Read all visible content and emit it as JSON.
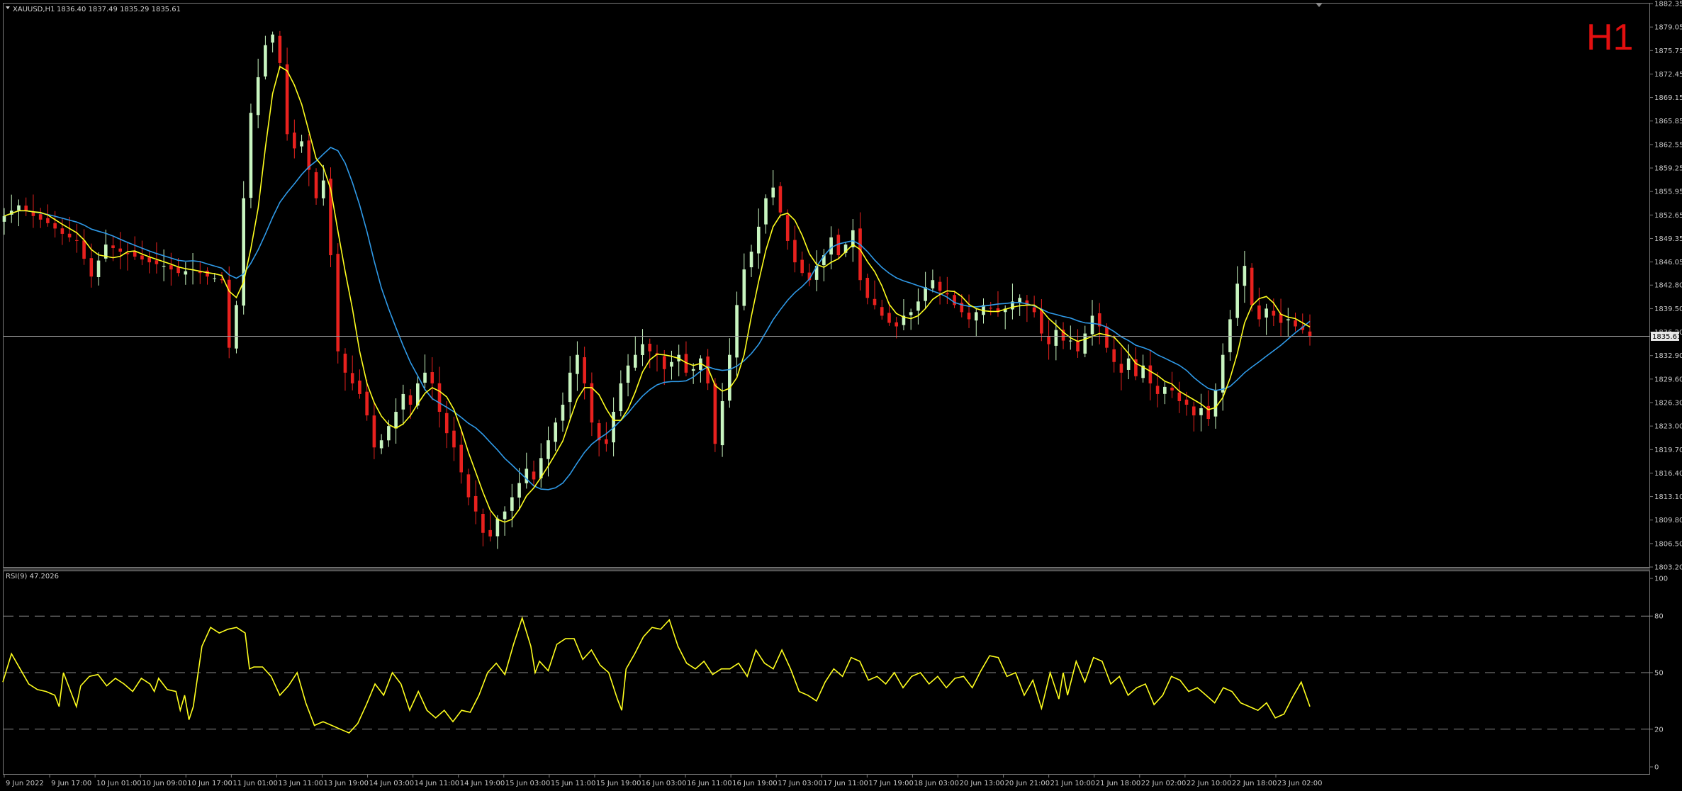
{
  "header": {
    "symbol": "XAUUSD,H1",
    "ohlc": "1836.40 1837.49 1835.29 1835.61",
    "menu_icon": "triangle-down-icon",
    "timeframe_badge": "H1"
  },
  "rsi_header": "RSI(9) 47.2026",
  "current_price_label": "1835.61",
  "colors": {
    "bull": "#c8f5c0",
    "bear": "#e8211e",
    "ma_fast": "#ffff1e",
    "ma_slow": "#2f9ae8",
    "rsi_line": "#ffff1e",
    "price_line": "#9a9a9a",
    "frame": "#7a7a7a",
    "badge": "#e30f0f"
  },
  "chart_data": [
    {
      "type": "candlestick",
      "title": "XAUUSD,H1",
      "ylim": [
        1803.2,
        1882.35
      ],
      "y_ticks": [
        "1882.35",
        "1879.05",
        "1875.75",
        "1872.45",
        "1869.15",
        "1865.85",
        "1862.55",
        "1859.25",
        "1855.95",
        "1852.65",
        "1849.35",
        "1846.05",
        "1842.80",
        "1839.50",
        "1836.20",
        "1832.90",
        "1829.60",
        "1826.30",
        "1823.00",
        "1819.70",
        "1816.40",
        "1813.10",
        "1809.80",
        "1806.50",
        "1803.20"
      ],
      "x_ticks": [
        "9 Jun 2022",
        "9 Jun 17:00",
        "10 Jun 01:00",
        "10 Jun 09:00",
        "10 Jun 17:00",
        "11 Jun 01:00",
        "13 Jun 11:00",
        "13 Jun 19:00",
        "14 Jun 03:00",
        "14 Jun 11:00",
        "14 Jun 19:00",
        "15 Jun 03:00",
        "15 Jun 11:00",
        "15 Jun 19:00",
        "16 Jun 03:00",
        "16 Jun 11:00",
        "16 Jun 19:00",
        "17 Jun 03:00",
        "17 Jun 11:00",
        "17 Jun 19:00",
        "18 Jun 03:00",
        "20 Jun 13:00",
        "20 Jun 21:00",
        "21 Jun 10:00",
        "21 Jun 18:00",
        "22 Jun 02:00",
        "22 Jun 10:00",
        "22 Jun 18:00",
        "23 Jun 02:00"
      ],
      "current_price": 1835.61,
      "close_path": [
        [
          0,
          1852.5
        ],
        [
          2,
          1854.0
        ],
        [
          4,
          1852.5
        ],
        [
          6,
          1851.5
        ],
        [
          8,
          1850.0
        ],
        [
          10,
          1849.0
        ],
        [
          12,
          1844.0
        ],
        [
          14,
          1848.5
        ],
        [
          16,
          1847.5
        ],
        [
          18,
          1846.8
        ],
        [
          20,
          1846.0
        ],
        [
          22,
          1845.5
        ],
        [
          24,
          1844.5
        ],
        [
          26,
          1845.0
        ],
        [
          28,
          1844.0
        ],
        [
          30,
          1843.5
        ],
        [
          31,
          1834.0
        ],
        [
          32,
          1840.0
        ],
        [
          33,
          1855.0
        ],
        [
          34,
          1867.0
        ],
        [
          35,
          1872.0
        ],
        [
          36,
          1876.5
        ],
        [
          37,
          1878.0
        ],
        [
          38,
          1874.0
        ],
        [
          39,
          1864.0
        ],
        [
          40,
          1862.0
        ],
        [
          41,
          1863.0
        ],
        [
          42,
          1859.0
        ],
        [
          43,
          1855.0
        ],
        [
          44,
          1857.5
        ],
        [
          45,
          1847.0
        ],
        [
          46,
          1833.5
        ],
        [
          47,
          1830.5
        ],
        [
          48,
          1829.0
        ],
        [
          49,
          1827.5
        ],
        [
          50,
          1824.5
        ],
        [
          51,
          1820.0
        ],
        [
          52,
          1821.0
        ],
        [
          53,
          1823.0
        ],
        [
          54,
          1825.0
        ],
        [
          55,
          1827.5
        ],
        [
          56,
          1826.0
        ],
        [
          57,
          1829.0
        ],
        [
          58,
          1830.5
        ],
        [
          59,
          1829.0
        ],
        [
          60,
          1825.0
        ],
        [
          61,
          1822.0
        ],
        [
          62,
          1820.0
        ],
        [
          63,
          1816.5
        ],
        [
          64,
          1813.0
        ],
        [
          65,
          1811.0
        ],
        [
          66,
          1808.0
        ],
        [
          67,
          1807.5
        ],
        [
          68,
          1810.0
        ],
        [
          69,
          1811.0
        ],
        [
          70,
          1813.0
        ],
        [
          71,
          1815.0
        ],
        [
          72,
          1817.0
        ],
        [
          73,
          1815.5
        ],
        [
          74,
          1818.5
        ],
        [
          75,
          1821.0
        ],
        [
          76,
          1823.5
        ],
        [
          77,
          1826.0
        ],
        [
          78,
          1830.5
        ],
        [
          79,
          1833.0
        ],
        [
          80,
          1829.0
        ],
        [
          81,
          1823.5
        ],
        [
          82,
          1821.0
        ],
        [
          83,
          1820.5
        ],
        [
          84,
          1825.0
        ],
        [
          85,
          1829.0
        ],
        [
          86,
          1831.5
        ],
        [
          87,
          1833.0
        ],
        [
          88,
          1834.5
        ],
        [
          89,
          1833.5
        ],
        [
          90,
          1833.0
        ],
        [
          91,
          1831.0
        ],
        [
          92,
          1832.0
        ],
        [
          93,
          1833.0
        ],
        [
          94,
          1830.5
        ],
        [
          95,
          1831.0
        ],
        [
          96,
          1832.5
        ],
        [
          97,
          1829.0
        ],
        [
          98,
          1820.5
        ],
        [
          99,
          1826.5
        ],
        [
          100,
          1833.0
        ],
        [
          101,
          1840.0
        ],
        [
          102,
          1845.0
        ],
        [
          103,
          1847.5
        ],
        [
          104,
          1851.0
        ],
        [
          105,
          1855.0
        ],
        [
          106,
          1856.5
        ],
        [
          107,
          1853.0
        ],
        [
          108,
          1849.0
        ],
        [
          109,
          1846.0
        ],
        [
          110,
          1844.5
        ],
        [
          111,
          1843.5
        ],
        [
          112,
          1845.5
        ],
        [
          113,
          1847.0
        ],
        [
          114,
          1849.5
        ],
        [
          115,
          1847.0
        ],
        [
          116,
          1848.5
        ],
        [
          117,
          1850.5
        ],
        [
          118,
          1843.5
        ],
        [
          119,
          1841.0
        ],
        [
          120,
          1840.0
        ],
        [
          121,
          1838.5
        ],
        [
          122,
          1837.5
        ],
        [
          123,
          1837.0
        ],
        [
          124,
          1838.5
        ],
        [
          125,
          1839.0
        ],
        [
          126,
          1840.5
        ],
        [
          127,
          1842.5
        ],
        [
          128,
          1843.5
        ],
        [
          129,
          1842.0
        ],
        [
          130,
          1841.5
        ],
        [
          131,
          1840.0
        ],
        [
          132,
          1839.0
        ],
        [
          133,
          1838.0
        ],
        [
          134,
          1839.0
        ],
        [
          135,
          1840.0
        ],
        [
          136,
          1839.5
        ],
        [
          137,
          1839.0
        ],
        [
          138,
          1839.5
        ],
        [
          139,
          1840.5
        ],
        [
          140,
          1841.0
        ],
        [
          141,
          1840.0
        ],
        [
          142,
          1839.0
        ],
        [
          143,
          1836.0
        ],
        [
          144,
          1834.5
        ],
        [
          145,
          1836.5
        ],
        [
          146,
          1835.0
        ],
        [
          147,
          1835.0
        ],
        [
          148,
          1833.5
        ],
        [
          149,
          1836.0
        ],
        [
          150,
          1838.5
        ],
        [
          151,
          1837.0
        ],
        [
          152,
          1834.0
        ],
        [
          153,
          1832.0
        ],
        [
          154,
          1830.5
        ],
        [
          155,
          1832.5
        ],
        [
          156,
          1830.0
        ],
        [
          157,
          1831.5
        ],
        [
          158,
          1829.0
        ],
        [
          159,
          1827.5
        ],
        [
          160,
          1828.5
        ],
        [
          161,
          1828.0
        ],
        [
          162,
          1826.5
        ],
        [
          163,
          1826.0
        ],
        [
          164,
          1824.5
        ],
        [
          165,
          1825.5
        ],
        [
          166,
          1824.0
        ],
        [
          167,
          1828.0
        ],
        [
          168,
          1833.0
        ],
        [
          169,
          1838.0
        ],
        [
          170,
          1843.0
        ],
        [
          171,
          1845.5
        ],
        [
          172,
          1840.0
        ],
        [
          173,
          1838.0
        ],
        [
          174,
          1839.5
        ],
        [
          175,
          1838.5
        ],
        [
          176,
          1837.5
        ],
        [
          177,
          1838.0
        ],
        [
          178,
          1837.0
        ],
        [
          179,
          1836.5
        ],
        [
          180,
          1835.61
        ]
      ],
      "series": [
        {
          "values": "fast moving average (yellow), computed from closes"
        },
        {
          "values": "slow moving average (blue), computed from closes"
        }
      ]
    },
    {
      "type": "line",
      "title": "RSI(9) 47.2026",
      "ylim": [
        0,
        100
      ],
      "y_ticks": [
        "100",
        "80",
        "50",
        "20",
        "0"
      ],
      "levels": [
        80,
        50,
        20
      ],
      "points": [
        [
          0,
          45
        ],
        [
          2,
          60
        ],
        [
          4,
          52
        ],
        [
          6,
          44
        ],
        [
          8,
          41
        ],
        [
          10,
          40
        ],
        [
          12,
          38
        ],
        [
          13,
          32
        ],
        [
          14,
          50
        ],
        [
          16,
          38
        ],
        [
          17,
          32
        ],
        [
          18,
          43
        ],
        [
          20,
          48
        ],
        [
          22,
          49
        ],
        [
          24,
          43
        ],
        [
          26,
          47
        ],
        [
          28,
          44
        ],
        [
          30,
          40
        ],
        [
          32,
          47
        ],
        [
          34,
          44
        ],
        [
          35,
          40
        ],
        [
          36,
          47
        ],
        [
          38,
          41
        ],
        [
          40,
          40
        ],
        [
          41,
          30
        ],
        [
          42,
          38
        ],
        [
          43,
          25
        ],
        [
          44,
          32
        ],
        [
          46,
          64
        ],
        [
          48,
          74
        ],
        [
          50,
          71
        ],
        [
          52,
          73
        ],
        [
          54,
          74
        ],
        [
          56,
          71
        ],
        [
          57,
          52
        ],
        [
          58,
          53
        ],
        [
          60,
          53
        ],
        [
          62,
          48
        ],
        [
          64,
          38
        ],
        [
          66,
          43
        ],
        [
          68,
          50
        ],
        [
          70,
          34
        ],
        [
          72,
          22
        ],
        [
          74,
          24
        ],
        [
          76,
          22
        ],
        [
          78,
          20
        ],
        [
          80,
          18
        ],
        [
          82,
          23
        ],
        [
          84,
          33
        ],
        [
          86,
          44
        ],
        [
          88,
          38
        ],
        [
          90,
          50
        ],
        [
          92,
          44
        ],
        [
          94,
          30
        ],
        [
          96,
          40
        ],
        [
          98,
          30
        ],
        [
          100,
          26
        ],
        [
          102,
          30
        ],
        [
          104,
          24
        ],
        [
          106,
          30
        ],
        [
          108,
          29
        ],
        [
          110,
          38
        ],
        [
          112,
          50
        ],
        [
          114,
          55
        ],
        [
          116,
          49
        ],
        [
          118,
          65
        ],
        [
          119,
          72
        ],
        [
          120,
          79
        ],
        [
          122,
          64
        ],
        [
          123,
          50
        ],
        [
          124,
          56
        ],
        [
          126,
          51
        ],
        [
          128,
          65
        ],
        [
          130,
          68
        ],
        [
          132,
          68
        ],
        [
          134,
          57
        ],
        [
          136,
          62
        ],
        [
          138,
          54
        ],
        [
          140,
          50
        ],
        [
          142,
          36
        ],
        [
          143,
          30
        ],
        [
          144,
          52
        ],
        [
          146,
          60
        ],
        [
          148,
          69
        ],
        [
          150,
          74
        ],
        [
          152,
          73
        ],
        [
          154,
          78
        ],
        [
          156,
          64
        ],
        [
          158,
          55
        ],
        [
          160,
          52
        ],
        [
          162,
          56
        ],
        [
          164,
          49
        ],
        [
          166,
          52
        ],
        [
          168,
          52
        ],
        [
          170,
          55
        ],
        [
          172,
          48
        ],
        [
          174,
          62
        ],
        [
          176,
          55
        ],
        [
          178,
          52
        ],
        [
          180,
          62
        ],
        [
          182,
          52
        ],
        [
          184,
          40
        ],
        [
          186,
          38
        ],
        [
          188,
          35
        ],
        [
          190,
          45
        ],
        [
          192,
          52
        ],
        [
          194,
          48
        ],
        [
          196,
          58
        ],
        [
          198,
          56
        ],
        [
          200,
          46
        ],
        [
          202,
          48
        ],
        [
          204,
          44
        ],
        [
          206,
          50
        ],
        [
          208,
          42
        ],
        [
          210,
          48
        ],
        [
          212,
          50
        ],
        [
          214,
          44
        ],
        [
          216,
          48
        ],
        [
          218,
          42
        ],
        [
          220,
          47
        ],
        [
          222,
          48
        ],
        [
          224,
          42
        ],
        [
          226,
          51
        ],
        [
          228,
          59
        ],
        [
          230,
          58
        ],
        [
          232,
          48
        ],
        [
          234,
          50
        ],
        [
          236,
          38
        ],
        [
          238,
          46
        ],
        [
          240,
          31
        ],
        [
          242,
          50
        ],
        [
          244,
          36
        ],
        [
          245,
          50
        ],
        [
          246,
          38
        ],
        [
          248,
          56
        ],
        [
          250,
          45
        ],
        [
          252,
          58
        ],
        [
          254,
          56
        ],
        [
          256,
          44
        ],
        [
          258,
          48
        ],
        [
          260,
          38
        ],
        [
          262,
          42
        ],
        [
          264,
          44
        ],
        [
          266,
          33
        ],
        [
          268,
          38
        ],
        [
          270,
          48
        ],
        [
          272,
          46
        ],
        [
          274,
          40
        ],
        [
          276,
          42
        ],
        [
          278,
          38
        ],
        [
          280,
          34
        ],
        [
          282,
          42
        ],
        [
          284,
          40
        ],
        [
          286,
          34
        ],
        [
          288,
          32
        ],
        [
          290,
          30
        ],
        [
          292,
          34
        ],
        [
          294,
          26
        ],
        [
          296,
          28
        ],
        [
          298,
          37
        ],
        [
          300,
          45
        ],
        [
          302,
          32
        ]
      ]
    }
  ]
}
